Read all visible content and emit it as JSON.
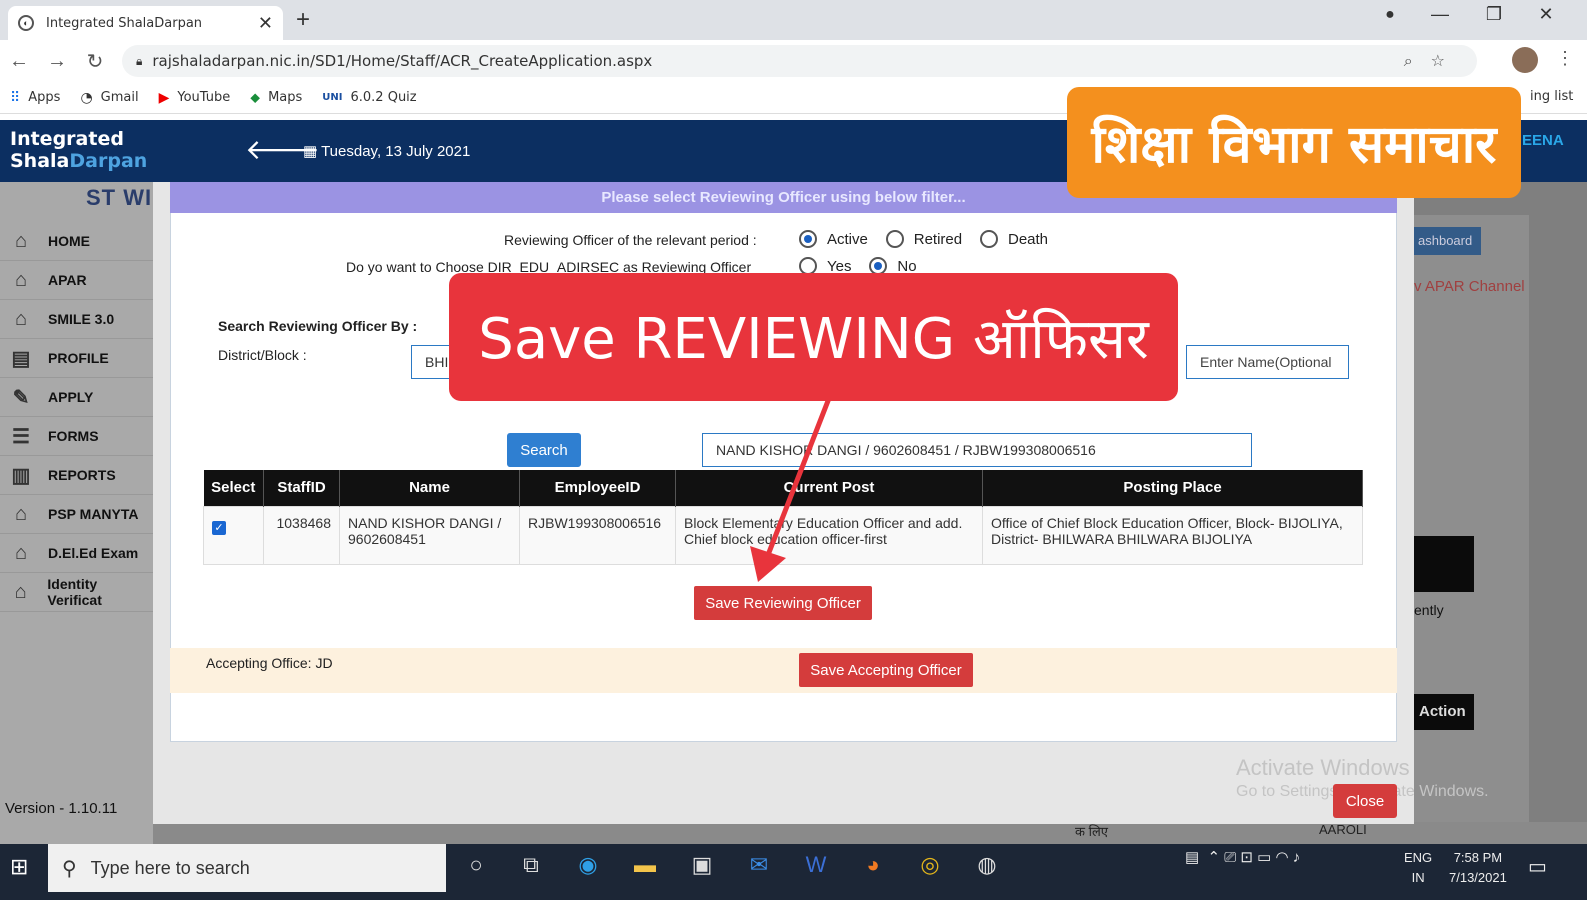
{
  "browser": {
    "tab_title": "Integrated ShalaDarpan",
    "url": "rajshaladarpan.nic.in/SD1/Home/Staff/ACR_CreateApplication.aspx",
    "bookmarks": [
      {
        "icon": "apps-grid-icon",
        "label": "Apps"
      },
      {
        "icon": "gmail-icon",
        "label": "Gmail"
      },
      {
        "icon": "youtube-icon",
        "label": "YouTube"
      },
      {
        "icon": "maps-icon",
        "label": "Maps"
      },
      {
        "icon": "quiz-icon",
        "label": "6.0.2 Quiz"
      }
    ],
    "bookmark_right": "ing list"
  },
  "header": {
    "logo_line1": "Integrated",
    "logo_line2a": "Shala",
    "logo_line2b": "Darpan",
    "date": "Tuesday, 13 July 2021",
    "user_partial": "EENA"
  },
  "sidebar": {
    "brand": "ST WIND",
    "items": [
      {
        "label": "HOME"
      },
      {
        "label": "APAR"
      },
      {
        "label": "SMILE 3.0"
      },
      {
        "label": "PROFILE"
      },
      {
        "label": "APPLY"
      },
      {
        "label": "FORMS"
      },
      {
        "label": "REPORTS"
      },
      {
        "label": "PSP MANYTA"
      },
      {
        "label": "D.El.Ed Exam"
      },
      {
        "label": "Identity Verificat"
      }
    ],
    "version": "Version - 1.10.11"
  },
  "background": {
    "dashboard": "ashboard",
    "apar_channel": "v APAR Channel",
    "recently": "ently",
    "action": "Action",
    "bottom_left": "क लिए",
    "bottom_right": "AAROLI"
  },
  "modal": {
    "filter_title": "Please select Reviewing Officer using below filter...",
    "period_label": "Reviewing Officer of the relevant period :",
    "period_options": [
      "Active",
      "Retired",
      "Death"
    ],
    "period_selected": "Active",
    "dir_label": "Do yo want to Choose DIR_EDU_ADIRSEC as Reviewing Officer",
    "dir_options": [
      "Yes",
      "No"
    ],
    "dir_selected": "No",
    "search_by": "Search Reviewing Officer By :",
    "district_label": "District/Block :",
    "district_value": "BHI",
    "name_placeholder": "Enter Name(Optional",
    "search_button": "Search",
    "selected_value": "NAND KISHOR DANGI / 9602608451 / RJBW199308006516",
    "table": {
      "headers": [
        "Select",
        "StaffID",
        "Name",
        "EmployeeID",
        "Current Post",
        "Posting Place"
      ],
      "rows": [
        {
          "staff_id": "1038468",
          "name": "NAND KISHOR DANGI / 9602608451",
          "employee_id": "RJBW199308006516",
          "current_post": "Block Elementary Education Officer and add. Chief block education officer-first",
          "posting_place": "Office of Chief Block Education Officer, Block- BIJOLIYA, District- BHILWARA BHILWARA BIJOLIYA"
        }
      ]
    },
    "save_reviewing": "Save Reviewing Officer",
    "accepting_label": "Accepting Office: JD",
    "save_accepting": "Save Accepting Officer",
    "close": "Close"
  },
  "overlays": {
    "orange_text": "शिक्षा विभाग समाचार",
    "red_text": "Save REVIEWING ऑफिसर"
  },
  "watermark": {
    "line1": "Activate Windows",
    "line2": "Go to Settings to activate Windows."
  },
  "taskbar": {
    "search_placeholder": "Type here to search",
    "lang1": "ENG",
    "lang2": "IN",
    "time": "7:58 PM",
    "date": "7/13/2021"
  }
}
